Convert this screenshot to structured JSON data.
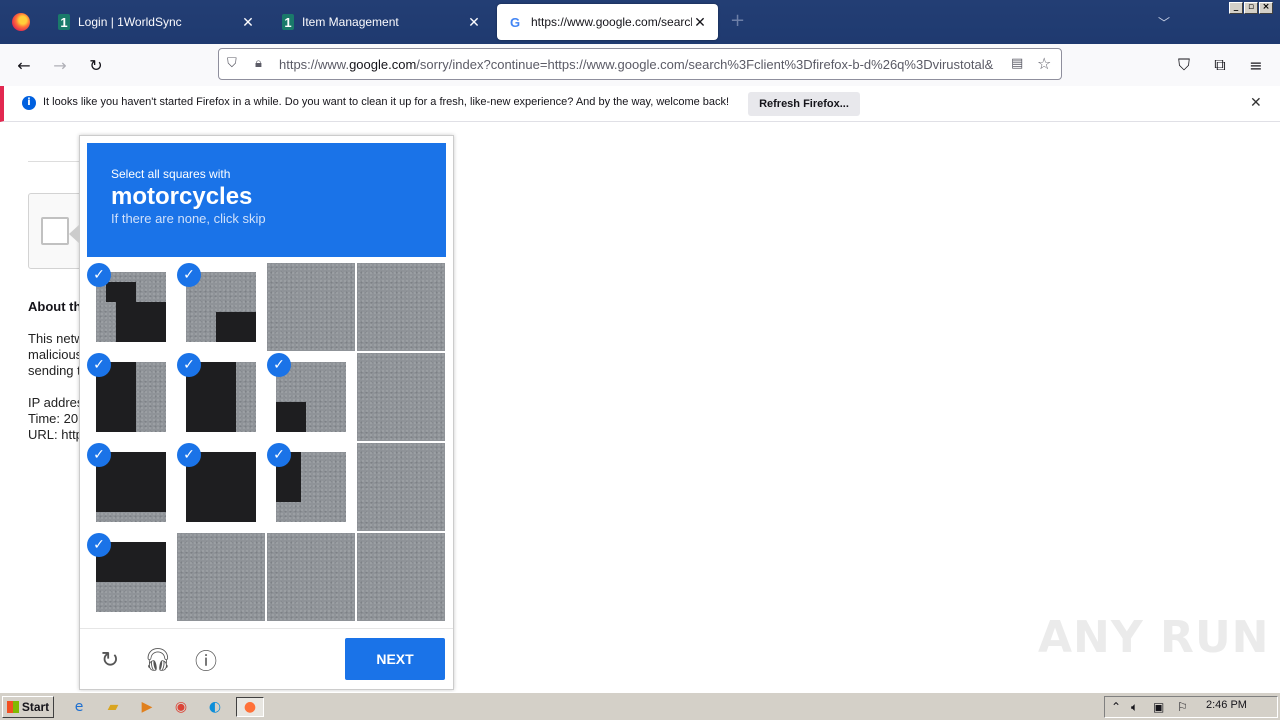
{
  "browser": {
    "tabs": [
      {
        "label": "Login | 1WorldSync",
        "favicon": "1worldsync-icon"
      },
      {
        "label": "Item Management",
        "favicon": "1worldsync-icon"
      },
      {
        "label": "https://www.google.com/search?c",
        "favicon": "google-icon"
      }
    ],
    "new_tab": "+",
    "url_prefix": "https://www.",
    "url_domain": "google.com",
    "url_rest": "/sorry/index?continue=https://www.google.com/search%3Fclient%3Dfirefox-b-d%26q%3Dvirustotal&"
  },
  "notification": {
    "message": "It looks like you haven't started Firefox in a while. Do you want to clean it up for a fresh, like-new experience? And by the way, welcome back!",
    "button": "Refresh Firefox..."
  },
  "page": {
    "about_heading": "About th",
    "lines": [
      "This netw",
      "malicious",
      "sending t",
      "",
      "IP addres",
      "Time: 20",
      "URL: http"
    ]
  },
  "captcha": {
    "instruction": "Select all squares with",
    "target": "motorcycles",
    "hint": "If there are none, click skip",
    "next": "NEXT",
    "selected": [
      0,
      1,
      4,
      5,
      6,
      8,
      9,
      10,
      12
    ],
    "accent": "#1a73e8"
  },
  "watermark": "ANY RUN",
  "taskbar": {
    "start": "Start",
    "clock": "2:46 PM"
  }
}
